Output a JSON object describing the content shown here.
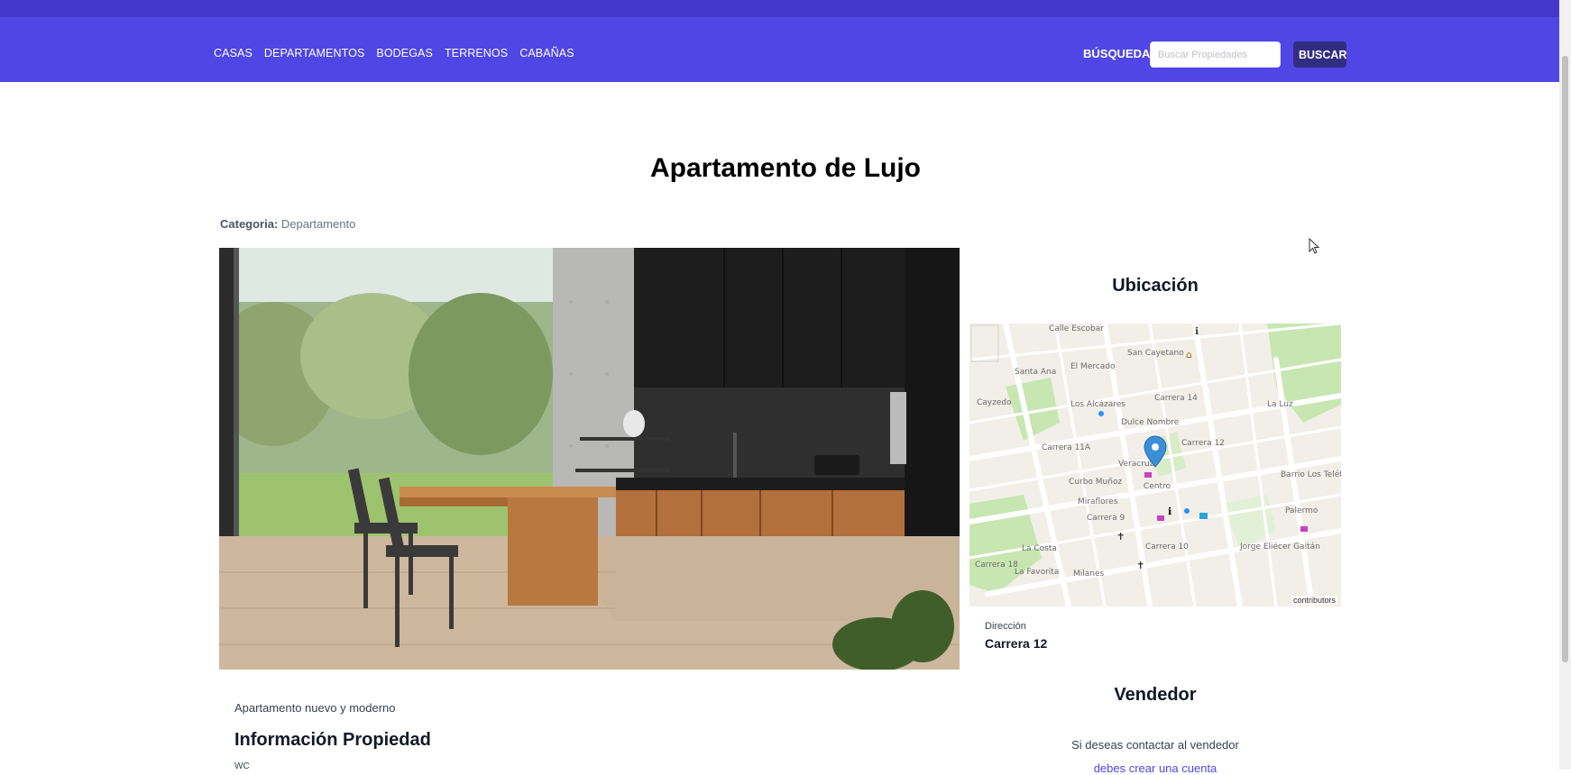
{
  "nav": {
    "links": [
      "CASAS",
      "DEPARTAMENTOS",
      "BODEGAS",
      "TERRENOS",
      "CABAÑAS"
    ],
    "search_label": "BÚSQUEDA",
    "search_placeholder": "Buscar Propiedades",
    "search_button": "BUSCAR"
  },
  "property": {
    "title": "Apartamento de Lujo",
    "category_label": "Categoria:",
    "category_value": "Departamento",
    "description": "Apartamento nuevo y moderno",
    "info_title": "Información Propiedad",
    "info_first_label": "WC"
  },
  "location": {
    "title": "Ubicación",
    "map_labels": [
      "Calle Escobar",
      "San Cayetano",
      "El Mercado",
      "Santa Ana",
      "Cayzedo",
      "Los Alcázares",
      "Dulce Nombre",
      "La Luz",
      "Carrera 11A",
      "Carrera 12",
      "Veracruz",
      "Centro",
      "Curbo Muñoz",
      "Miraflores",
      "Barrio Los Teléfonos",
      "Palermo",
      "Jorge Eliécer Gaitán",
      "La Costa",
      "La Favorita",
      "Milanes",
      "Carrera 9",
      "Carrera 10",
      "Carrera 14",
      "Carrera 18"
    ],
    "map_attribution": "contributors",
    "address_label": "Dirección",
    "address_value": "Carrera 12"
  },
  "seller": {
    "title": "Vendedor",
    "contact_text": "Si deseas contactar al vendedor",
    "contact_link": "debes crear una cuenta"
  },
  "colors": {
    "nav_bg": "#4f46e5",
    "nav_button": "#312e81",
    "map_marker": "#3b8ed8"
  }
}
